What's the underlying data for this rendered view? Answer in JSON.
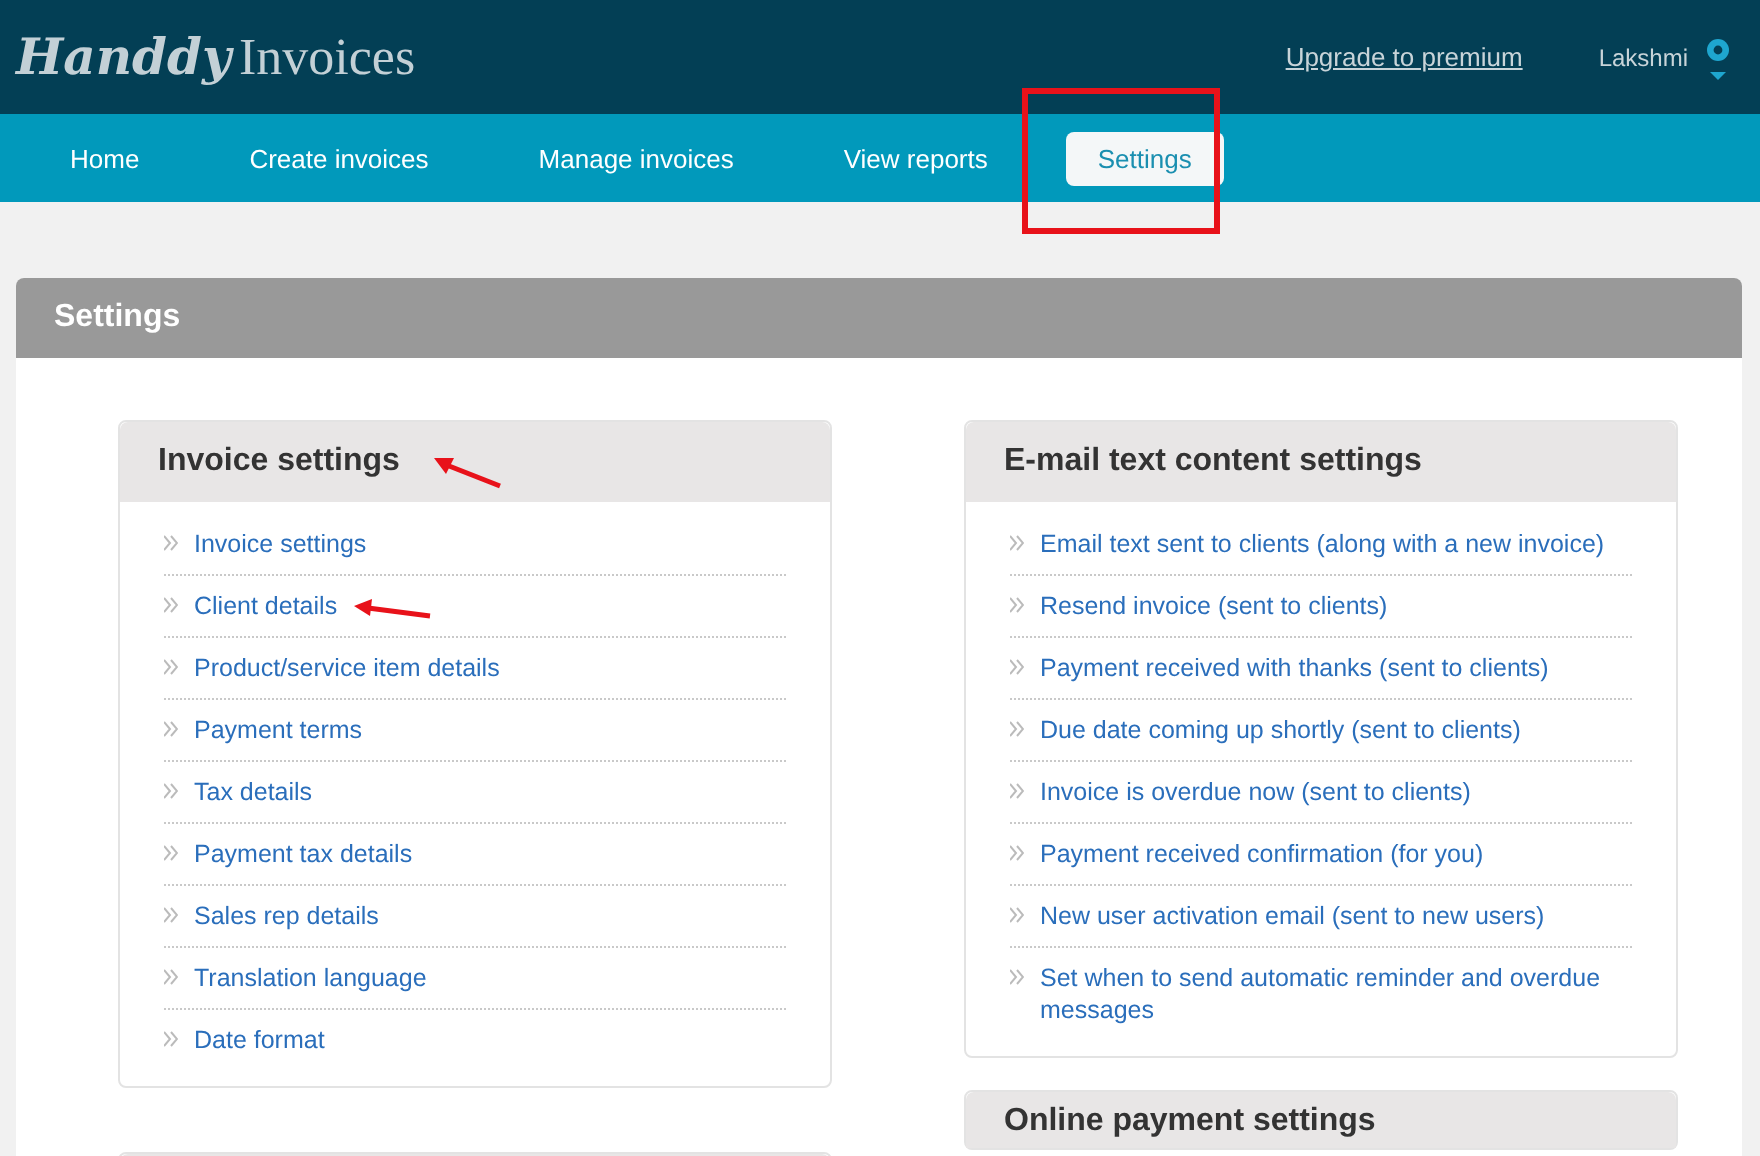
{
  "header": {
    "logo": {
      "script": "Handdy",
      "word": "Invoices"
    },
    "upgrade_link": "Upgrade to premium",
    "user": "Lakshmi"
  },
  "nav": [
    {
      "label": "Home",
      "selected": false
    },
    {
      "label": "Create invoices",
      "selected": false
    },
    {
      "label": "Manage invoices",
      "selected": false
    },
    {
      "label": "View reports",
      "selected": false
    },
    {
      "label": "Settings",
      "selected": true
    }
  ],
  "panel": {
    "title": "Settings",
    "cards": [
      {
        "kind": "list",
        "title": "Invoice settings",
        "items": [
          "Invoice settings",
          "Client details",
          "Product/service item details",
          "Payment terms",
          "Tax details",
          "Payment tax details",
          "Sales rep details",
          "Translation language",
          "Date format"
        ]
      },
      {
        "kind": "list",
        "title": "E-mail text content settings",
        "items": [
          "Email text sent to clients (along with a new invoice)",
          "Resend invoice (sent to clients)",
          "Payment received with thanks (sent to clients)",
          "Due date coming up shortly (sent to clients)",
          "Invoice is overdue now (sent to clients)",
          "Payment received confirmation (for you)",
          "New user activation email (sent to new users)",
          "Set when to send automatic reminder and overdue messages"
        ]
      },
      {
        "kind": "untitled"
      },
      {
        "kind": "heading",
        "title": "Online payment settings"
      }
    ]
  }
}
